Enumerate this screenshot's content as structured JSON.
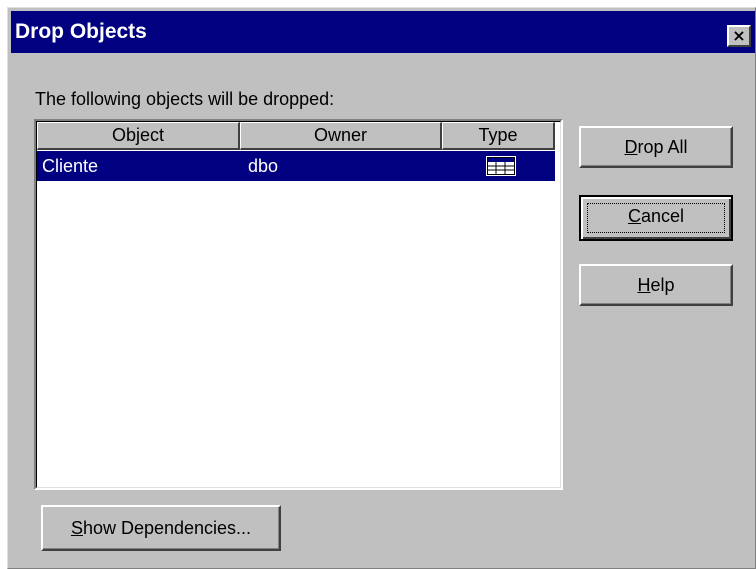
{
  "window": {
    "title": "Drop Objects",
    "close_label": "×"
  },
  "instruction": "The following objects will be dropped:",
  "list": {
    "columns": [
      "Object",
      "Owner",
      "Type"
    ],
    "rows": [
      {
        "object": "Cliente",
        "owner": "dbo",
        "type_icon": "table-icon"
      }
    ]
  },
  "buttons": {
    "drop_all": {
      "mnemonic": "D",
      "rest": "rop All"
    },
    "cancel": {
      "mnemonic": "C",
      "rest": "ancel"
    },
    "help": {
      "mnemonic": "H",
      "rest": "elp"
    },
    "show_dependencies": {
      "mnemonic": "S",
      "rest": "how Dependencies..."
    }
  },
  "colors": {
    "titlebar": "#000080",
    "face": "#c0c0c0",
    "selection": "#000080"
  }
}
